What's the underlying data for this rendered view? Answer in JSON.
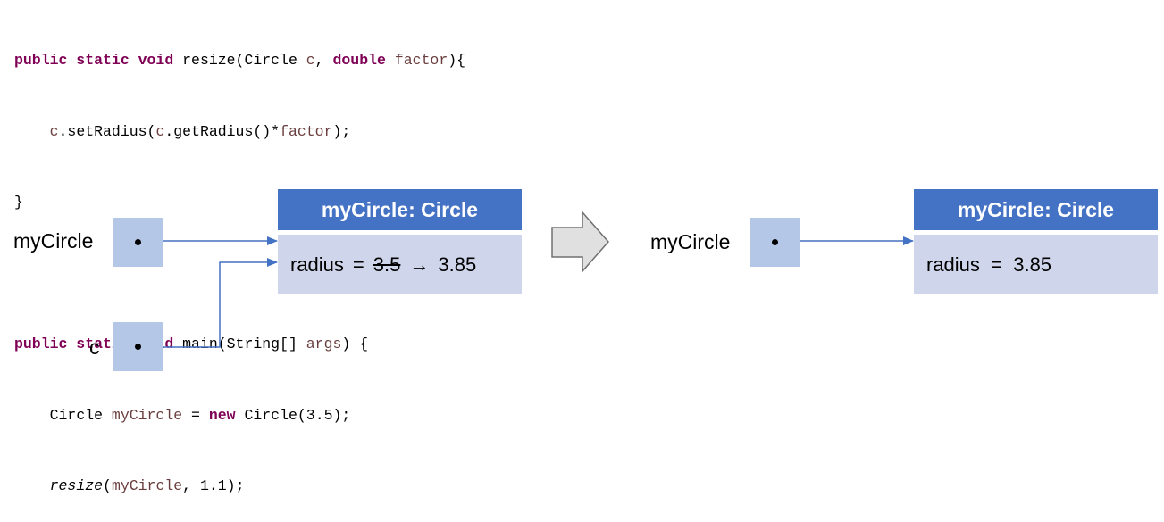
{
  "code": {
    "line1": {
      "kw1": "public static void",
      "name": " resize(Circle ",
      "p1": "c",
      "mid": ", ",
      "kw2": "double",
      "sp": " ",
      "p2": "factor",
      "end": "){"
    },
    "line2": {
      "indent": "    ",
      "a": "c",
      "b": ".setRadius(",
      "c": "c",
      "d": ".getRadius()*",
      "e": "factor",
      "f": ");"
    },
    "line3": {
      "text": "}"
    },
    "line5": {
      "kw1": "public static void",
      "name": " main(String[] ",
      "p1": "args",
      "end": ") {"
    },
    "line6": {
      "indent": "    ",
      "type": "Circle ",
      "var": "myCircle",
      "eq": " = ",
      "kw": "new",
      "rest": " Circle(3.5);"
    },
    "line7": {
      "indent": "    ",
      "fn": "resize",
      "open": "(",
      "var": "myCircle",
      "rest": ", 1.1);"
    }
  },
  "diagram_before": {
    "label_myCircle": "myCircle",
    "label_c": "c",
    "object_header": "myCircle: Circle",
    "radius_label": "radius",
    "equals": "=",
    "old_value": "3.5",
    "arrow": "→",
    "new_value": "3.85"
  },
  "diagram_after": {
    "label_myCircle": "myCircle",
    "object_header": "myCircle: Circle",
    "radius_text": "radius  =  3.85"
  },
  "colors": {
    "header_blue": "#4472c4",
    "ref_box": "#b4c7e7",
    "object_body": "#cfd5ea",
    "arrow_line": "#4472c4",
    "keyword": "#7f0055",
    "variable": "#6a3e3e"
  }
}
